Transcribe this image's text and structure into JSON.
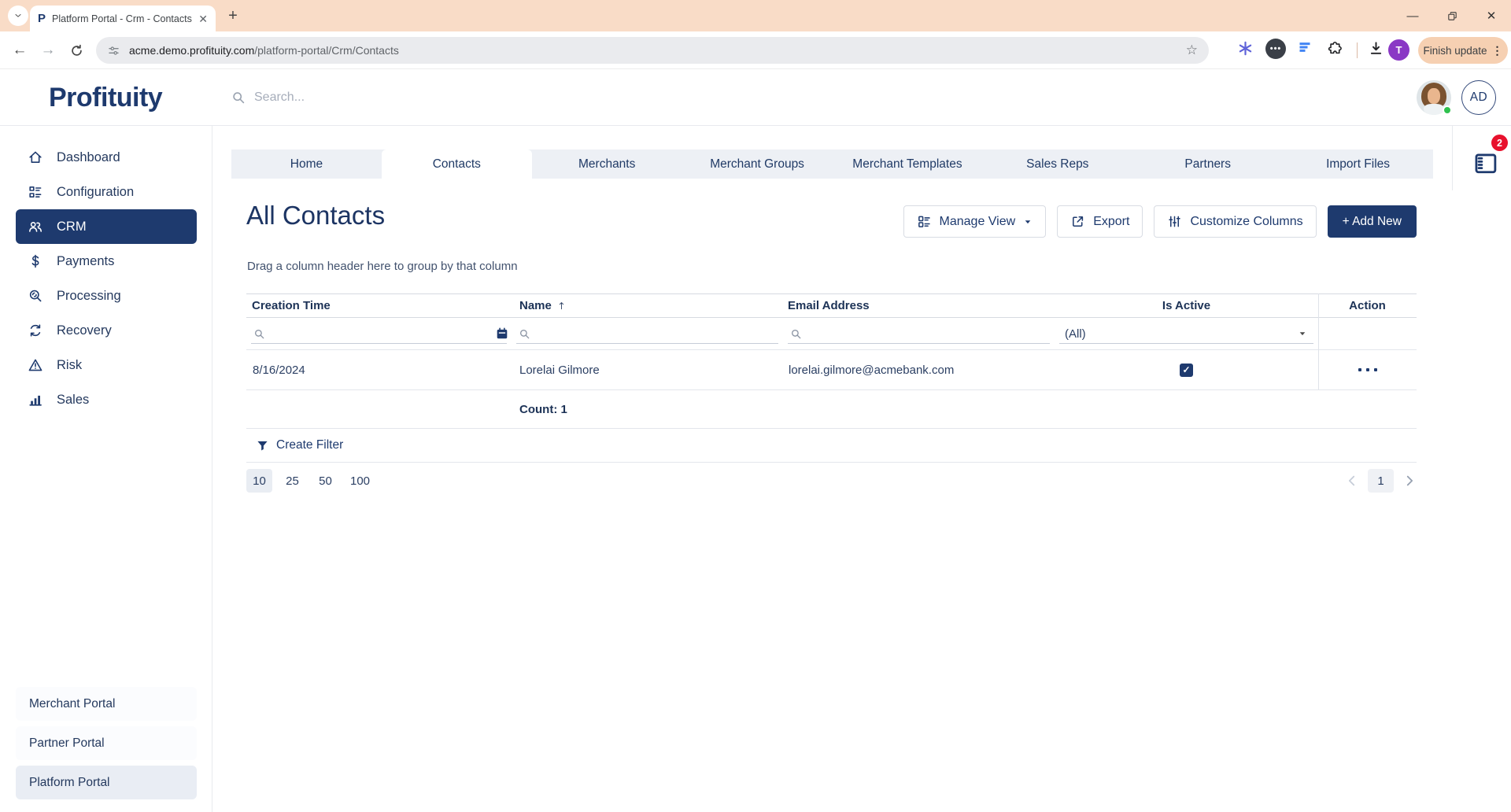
{
  "browser": {
    "tab": {
      "title": "Platform Portal - Crm - Contacts",
      "favicon_letter": "P"
    },
    "url_domain": "acme.demo.profituity.com",
    "url_path": "/platform-portal/Crm/Contacts",
    "profile_letter": "T",
    "update_button": "Finish update"
  },
  "header": {
    "logo": "Profituity",
    "search_placeholder": "Search...",
    "user_initials": "AD"
  },
  "sidebar": {
    "items": [
      {
        "label": "Dashboard",
        "icon": "home-icon"
      },
      {
        "label": "Configuration",
        "icon": "layout-icon"
      },
      {
        "label": "CRM",
        "icon": "people-icon",
        "active": true
      },
      {
        "label": "Payments",
        "icon": "dollar-icon"
      },
      {
        "label": "Processing",
        "icon": "search-sync-icon"
      },
      {
        "label": "Recovery",
        "icon": "refresh-icon"
      },
      {
        "label": "Risk",
        "icon": "warning-icon"
      },
      {
        "label": "Sales",
        "icon": "bar-chart-icon"
      }
    ],
    "portals": [
      {
        "label": "Merchant Portal"
      },
      {
        "label": "Partner Portal"
      },
      {
        "label": "Platform Portal",
        "active": true
      }
    ]
  },
  "tabs": [
    {
      "label": "Home"
    },
    {
      "label": "Contacts",
      "active": true
    },
    {
      "label": "Merchants"
    },
    {
      "label": "Merchant Groups"
    },
    {
      "label": "Merchant Templates"
    },
    {
      "label": "Sales Reps"
    },
    {
      "label": "Partners"
    },
    {
      "label": "Import Files"
    }
  ],
  "page": {
    "title": "All Contacts",
    "buttons": {
      "manage_view": "Manage View",
      "export": "Export",
      "customize_columns": "Customize Columns",
      "add_new": "+ Add New"
    },
    "group_hint": "Drag a column header here to group by that column",
    "table": {
      "headers": {
        "creation_time": "Creation Time",
        "name": "Name",
        "email": "Email Address",
        "is_active": "Is Active",
        "action": "Action"
      },
      "filters": {
        "is_active": "(All)"
      },
      "rows": [
        {
          "creation_time": "8/16/2024",
          "name": "Lorelai Gilmore",
          "email": "lorelai.gilmore@acmebank.com",
          "is_active": true
        }
      ],
      "count": "Count: 1"
    },
    "create_filter": "Create Filter",
    "pagination": {
      "sizes": [
        "10",
        "25",
        "50",
        "100"
      ],
      "active_size": "10",
      "page": "1"
    },
    "notifications_badge": "2"
  },
  "colors": {
    "primary": "#1e3a6e",
    "browser_theme": "#f9dcc7",
    "badge_red": "#e8112d",
    "tabbar_bg": "#edf0f5"
  }
}
